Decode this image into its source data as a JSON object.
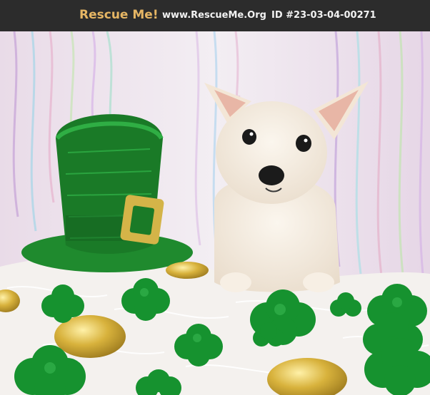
{
  "header": {
    "logo_text": "Rescue Me!",
    "site_url": "www.RescueMe.Org",
    "pet_id": "ID #23-03-04-00271"
  },
  "colors": {
    "header_bg": "#2c2c2c",
    "logo": "#e6b664",
    "header_text": "#f2f2f2"
  },
  "photo": {
    "subject": "white puppy beside green leprechaun hat with gold buckle, shamrocks and gold coins on white fur"
  }
}
